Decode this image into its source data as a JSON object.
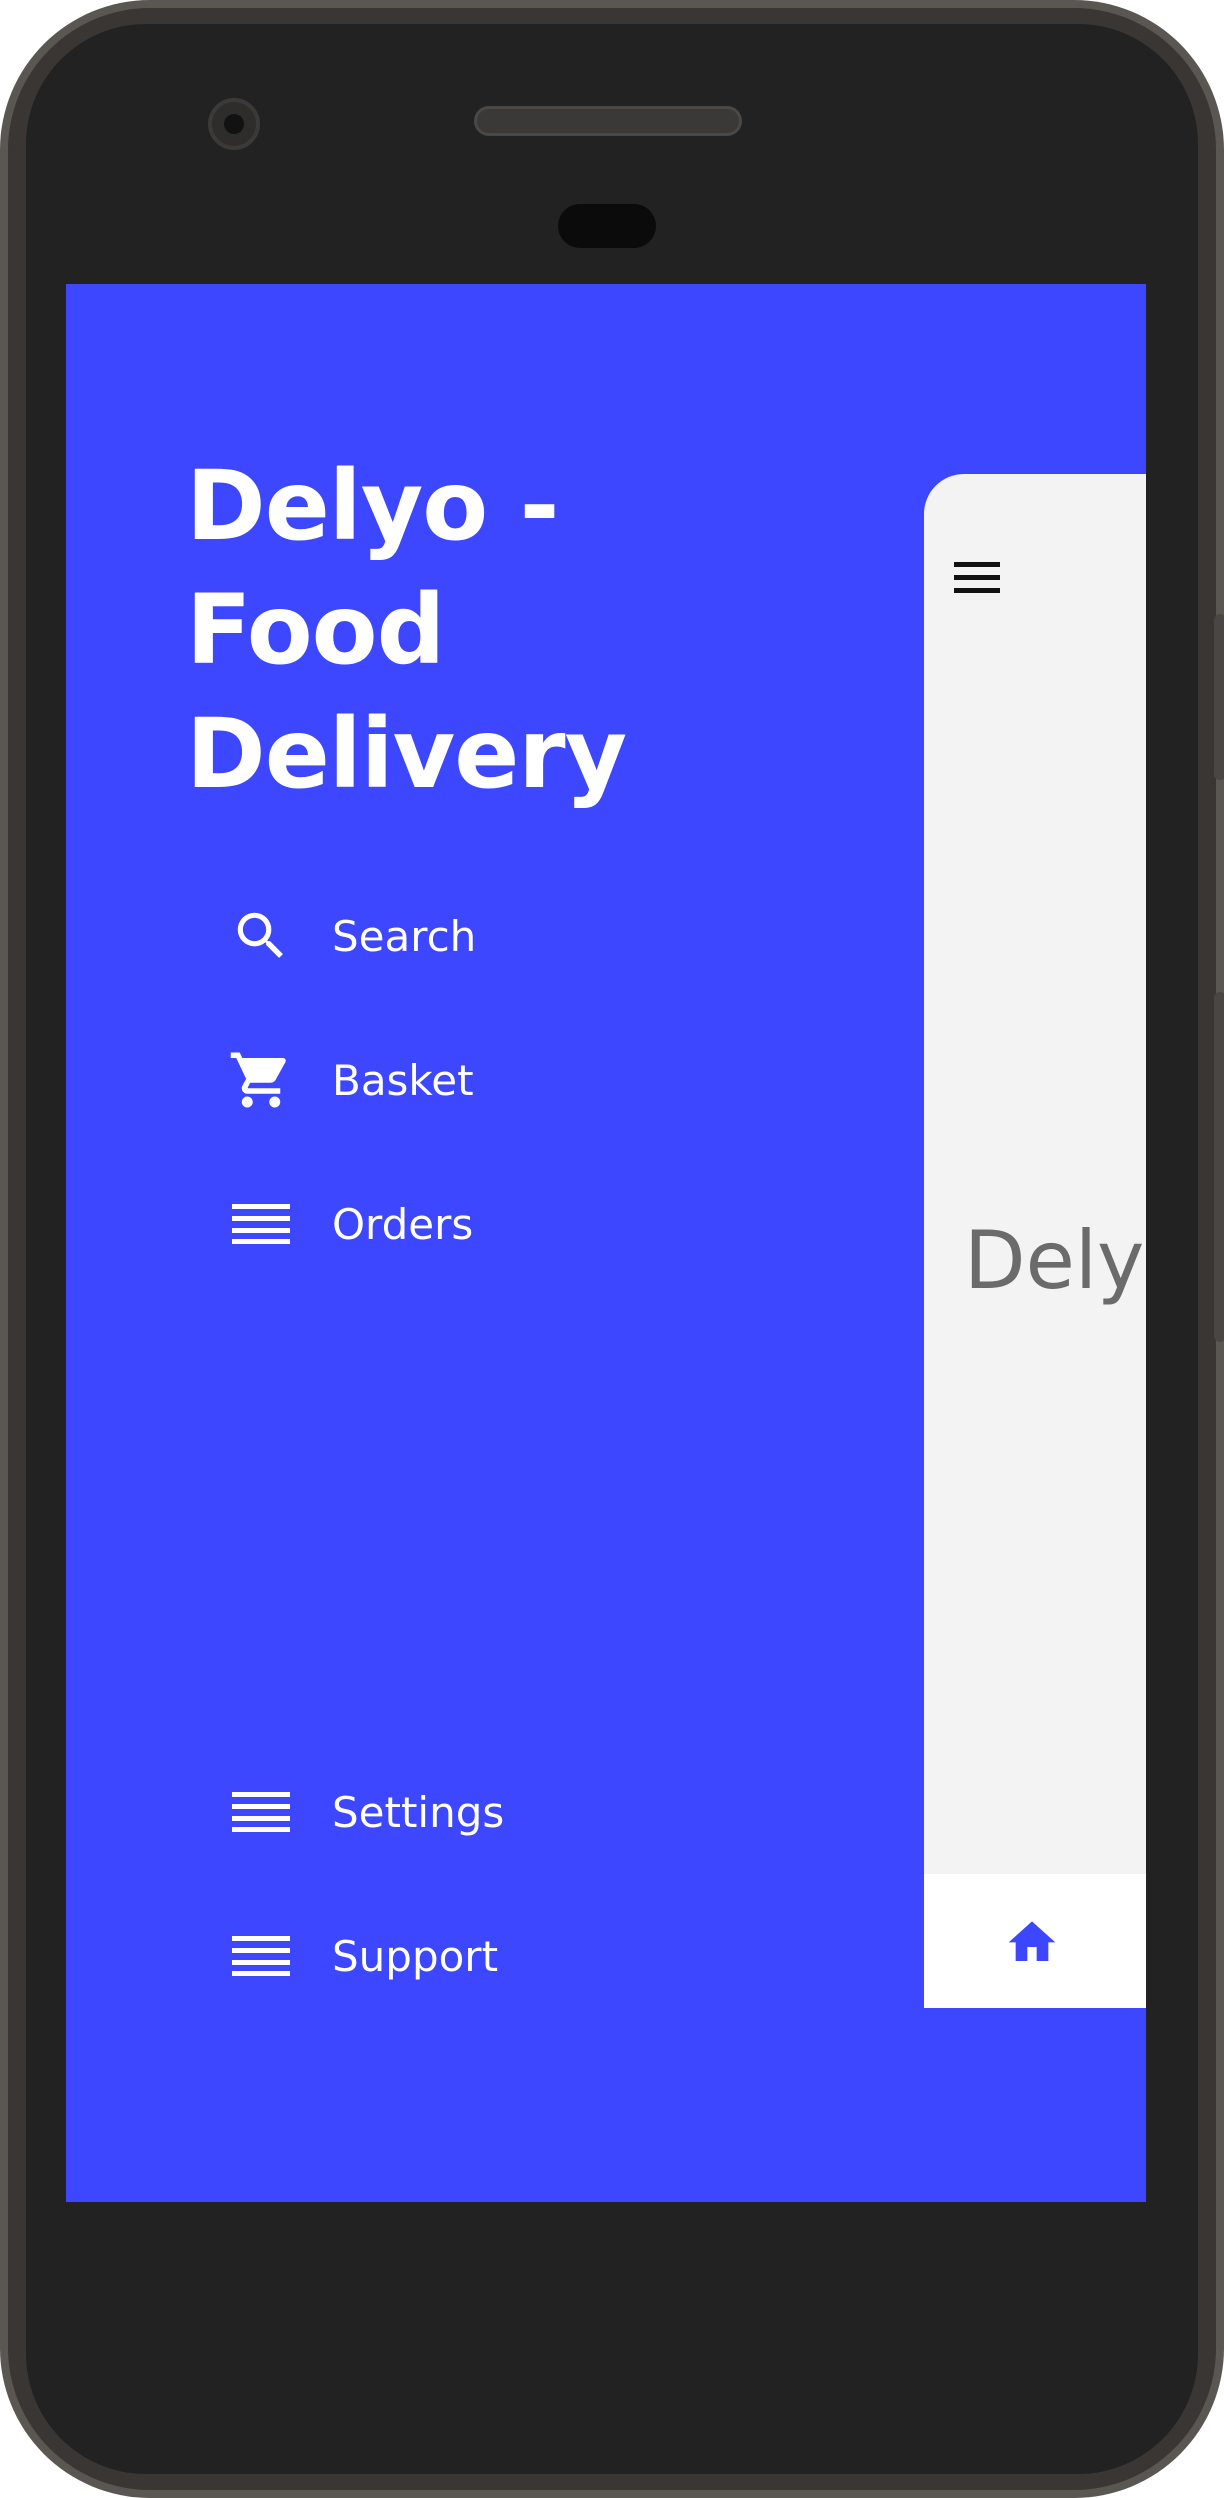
{
  "app": {
    "title": "Delyo - Food Delivery",
    "accent_color": "#3d47ff"
  },
  "drawer": {
    "top_items": [
      {
        "label": "Search",
        "icon": "search-icon"
      },
      {
        "label": "Basket",
        "icon": "cart-icon"
      },
      {
        "label": "Orders",
        "icon": "menu-icon"
      }
    ],
    "bottom_items": [
      {
        "label": "Settings",
        "icon": "menu-icon"
      },
      {
        "label": "Support",
        "icon": "menu-icon"
      }
    ]
  },
  "content": {
    "title_partial": "Delyo",
    "menu_icon": "menu-icon",
    "bottom_nav": {
      "home_icon": "home-icon"
    }
  }
}
